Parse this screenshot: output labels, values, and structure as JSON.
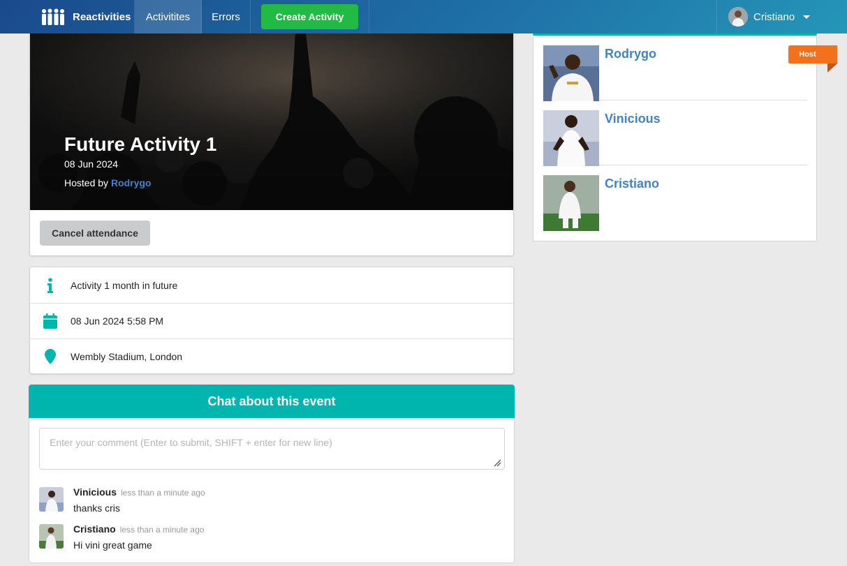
{
  "nav": {
    "brand": "Reactivities",
    "activities": "Activitites",
    "errors": "Errors",
    "create": "Create Activity",
    "user": "Cristiano"
  },
  "activity": {
    "title": "Future Activity 1",
    "date": "08 Jun 2024",
    "hosted_by_label": "Hosted by",
    "host": "Rodrygo",
    "cancel_label": "Cancel attendance",
    "description": "Activity 1 month in future",
    "datetime": "08 Jun 2024 5:58 PM",
    "venue": "Wembly Stadium, London"
  },
  "chat": {
    "header": "Chat about this event",
    "placeholder": "Enter your comment (Enter to submit, SHIFT + enter for new line)",
    "comments": [
      {
        "author": "Vinicious",
        "time": "less than a minute ago",
        "text": "thanks cris"
      },
      {
        "author": "Cristiano",
        "time": "less than a minute ago",
        "text": "Hi vini great game"
      }
    ]
  },
  "attendees": {
    "host_label": "Host",
    "items": [
      {
        "name": "Rodrygo"
      },
      {
        "name": "Vinicious"
      },
      {
        "name": "Cristiano"
      }
    ]
  },
  "colors": {
    "teal": "#00b5ad",
    "green": "#21ba45",
    "orange": "#f2711c",
    "link": "#4183c4"
  },
  "icons": [
    "users-icon",
    "caret-down-icon",
    "info-icon",
    "calendar-icon",
    "map-marker-icon",
    "resize-icon"
  ]
}
